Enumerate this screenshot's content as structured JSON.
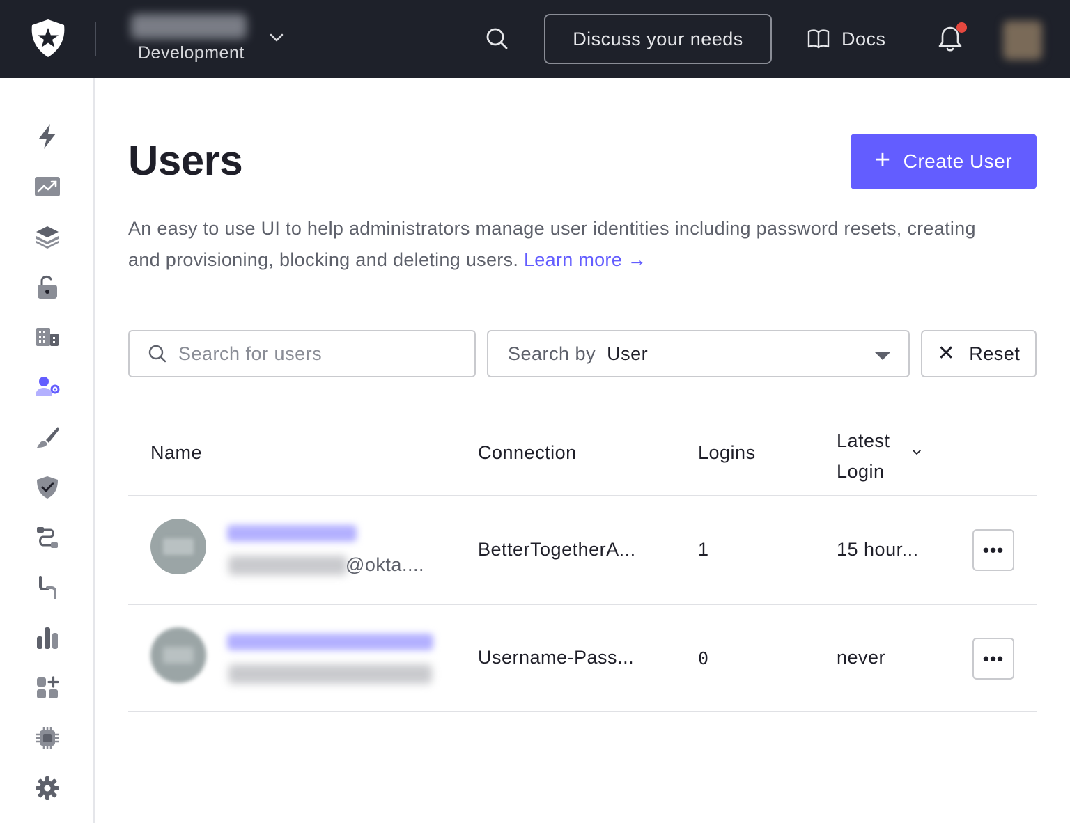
{
  "topbar": {
    "tenant_environment": "Development",
    "discuss_label": "Discuss your needs",
    "docs_label": "Docs",
    "notification_dot_color": "#e5483f"
  },
  "sidebar": {
    "items": [
      {
        "name": "getting-started",
        "icon": "lightning-icon"
      },
      {
        "name": "activity",
        "icon": "trend-chart-icon"
      },
      {
        "name": "applications",
        "icon": "layers-icon"
      },
      {
        "name": "authentication",
        "icon": "unlock-icon"
      },
      {
        "name": "organizations",
        "icon": "building-icon"
      },
      {
        "name": "user-management",
        "icon": "user-gear-icon",
        "active": true
      },
      {
        "name": "branding",
        "icon": "brush-icon"
      },
      {
        "name": "security",
        "icon": "shield-check-icon"
      },
      {
        "name": "actions",
        "icon": "flow-icon"
      },
      {
        "name": "auth-pipeline",
        "icon": "pipeline-icon"
      },
      {
        "name": "monitoring",
        "icon": "bar-chart-icon"
      },
      {
        "name": "marketplace",
        "icon": "add-apps-icon"
      },
      {
        "name": "extensions",
        "icon": "chip-icon"
      },
      {
        "name": "settings",
        "icon": "gear-icon"
      }
    ]
  },
  "main": {
    "title": "Users",
    "create_label": "Create User",
    "description": "An easy to use UI to help administrators manage user identities including password resets, creating and provisioning, blocking and deleting users.",
    "learn_more": "Learn more →",
    "search_placeholder": "Search for users",
    "search_by_label": "Search by",
    "search_by_value": "User",
    "reset_label": "Reset",
    "accent_color": "#635dff"
  },
  "table": {
    "headers": {
      "name": "Name",
      "connection": "Connection",
      "logins": "Logins",
      "latest_login": "Latest Login"
    },
    "rows": [
      {
        "email_suffix": "@okta....",
        "connection": "BetterTogetherA...",
        "logins": "1",
        "latest_login": "15 hour..."
      },
      {
        "email_suffix": "",
        "connection": "Username-Pass...",
        "logins": "0",
        "latest_login": "never"
      }
    ],
    "more_label": "•••"
  }
}
